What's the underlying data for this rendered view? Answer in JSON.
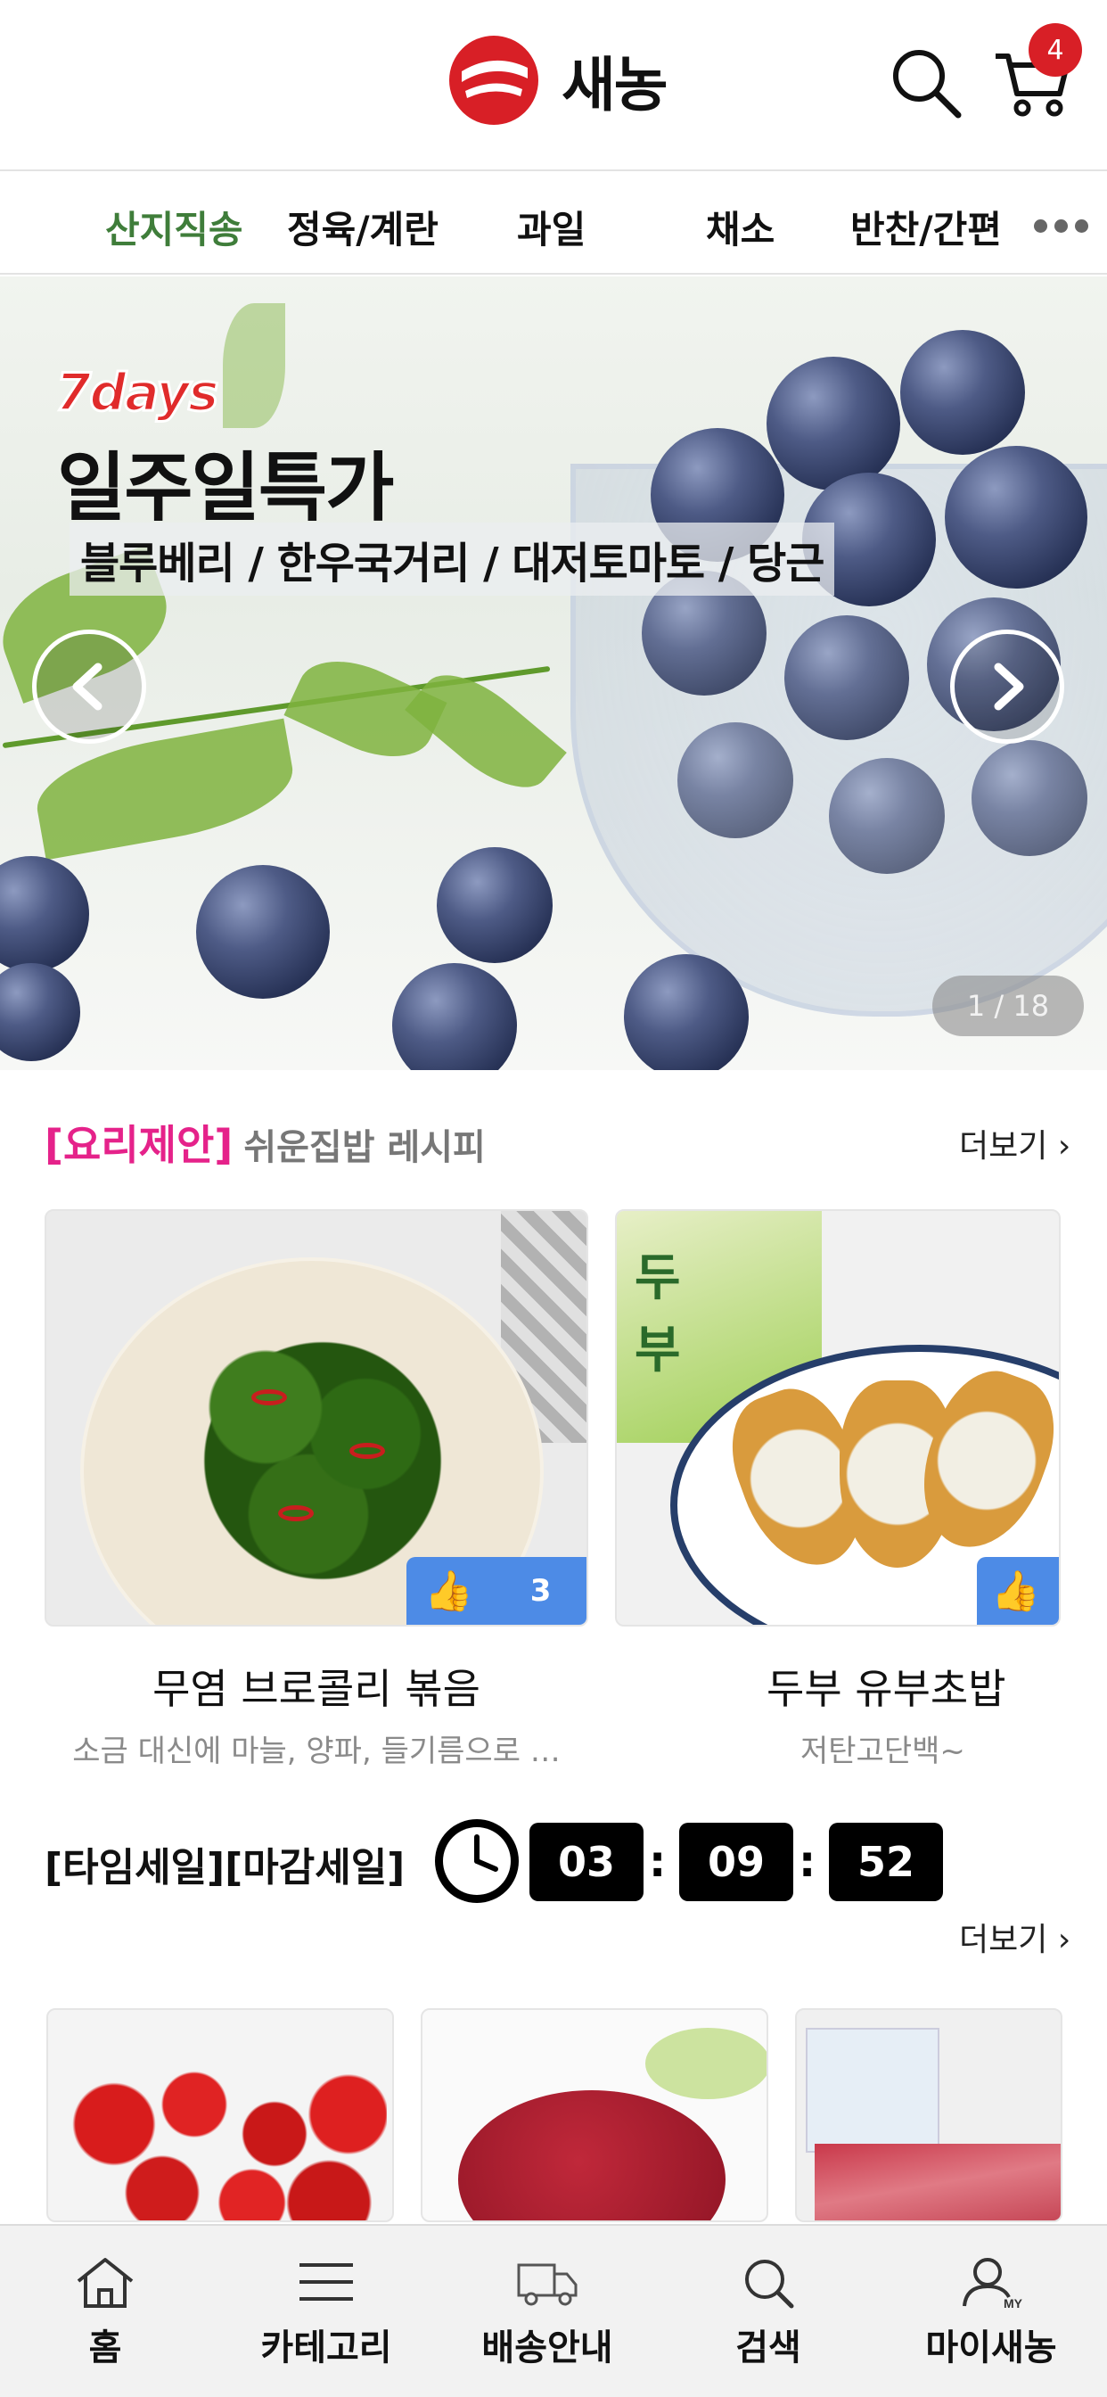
{
  "header": {
    "brand": "새농",
    "cart_count": "4"
  },
  "categories": [
    "산지직송",
    "정육/계란",
    "과일",
    "채소",
    "반찬/간편"
  ],
  "banner": {
    "tag": "7days",
    "title": "일주일특가",
    "subtitle": "블루베리 / 한우국거리 / 대저토마토 / 당근",
    "counter": "1 / 18"
  },
  "recipe": {
    "heading": "[요리제안]",
    "subheading": "쉬운집밥 레시피",
    "more": "더보기",
    "cards": [
      {
        "title": "무염 브로콜리 볶음",
        "desc": "소금 대신에 마늘, 양파, 들기름으로 …",
        "likes": "3"
      },
      {
        "title": "두부 유부초밥",
        "desc": "저탄고단백~",
        "likes": ""
      }
    ]
  },
  "timesale": {
    "label": "[타임세일][마감세일]",
    "hours": "03",
    "minutes": "09",
    "seconds": "52",
    "more": "더보기"
  },
  "bottom_nav": [
    "홈",
    "카테고리",
    "배송안내",
    "검색",
    "마이새농"
  ],
  "colors": {
    "brand_red": "#d81f26",
    "active_category": "#3f7d3a",
    "recipe_pink": "#e5228a",
    "like_blue": "#4d8be6"
  }
}
